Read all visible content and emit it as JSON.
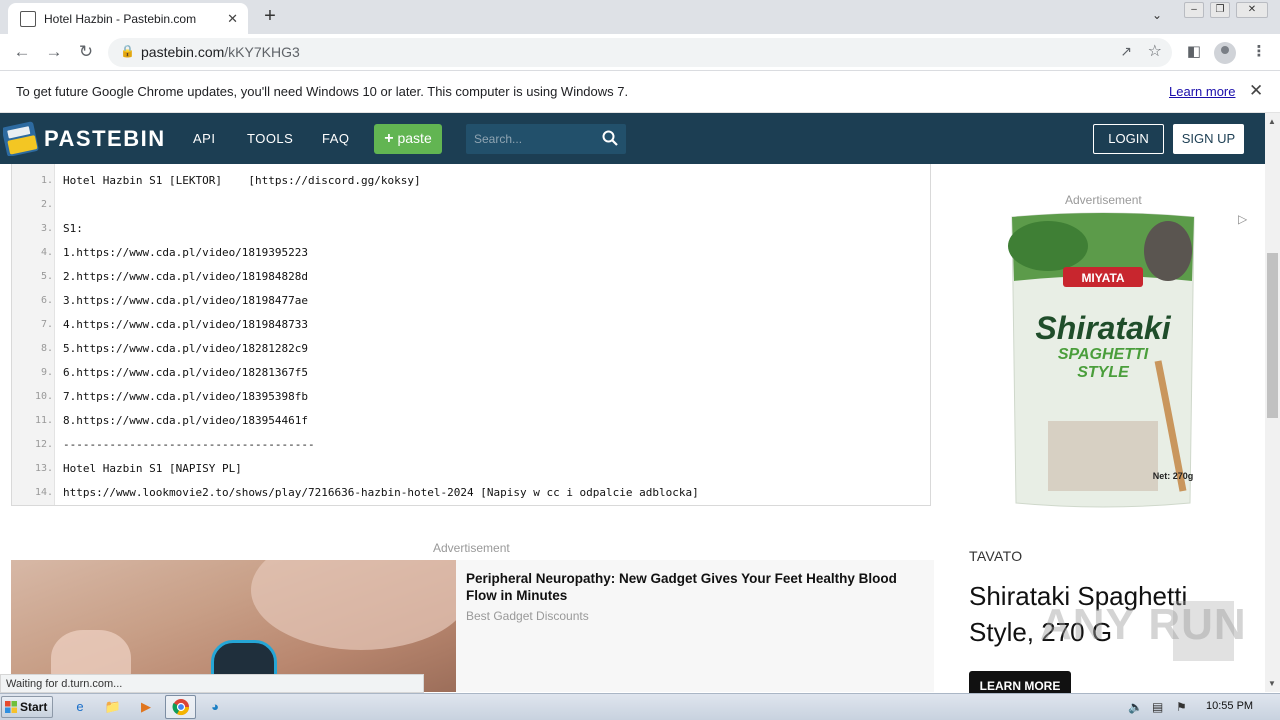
{
  "browser": {
    "tab_title": "Hotel Hazbin - Pastebin.com",
    "tab_close": "✕",
    "new_tab": "+",
    "url_host": "pastebin.com",
    "url_path": "/kKY7KHG3",
    "infobar_message": "To get future Google Chrome updates, you'll need Windows 10 or later. This computer is using Windows 7.",
    "infobar_link": "Learn more",
    "status_text": "Waiting for d.turn.com..."
  },
  "header": {
    "brand": "PASTEBIN",
    "nav": [
      "API",
      "TOOLS",
      "FAQ"
    ],
    "paste_label": "paste",
    "search_placeholder": "Search...",
    "login": "LOGIN",
    "signup": "SIGN UP"
  },
  "paste": {
    "lines": [
      {
        "n": "1.",
        "text": "Hotel Hazbin S1 [LEKTOR]    [https://discord.gg/koksy]"
      },
      {
        "n": "2.",
        "text": ""
      },
      {
        "n": "3.",
        "text": "S1:"
      },
      {
        "n": "4.",
        "text": "1.https://www.cda.pl/video/1819395223"
      },
      {
        "n": "5.",
        "text": "2.https://www.cda.pl/video/181984828d"
      },
      {
        "n": "6.",
        "text": "3.https://www.cda.pl/video/18198477ae"
      },
      {
        "n": "7.",
        "text": "4.https://www.cda.pl/video/1819848733"
      },
      {
        "n": "8.",
        "text": "5.https://www.cda.pl/video/18281282c9"
      },
      {
        "n": "9.",
        "text": "6.https://www.cda.pl/video/18281367f5"
      },
      {
        "n": "10.",
        "text": "7.https://www.cda.pl/video/18395398fb"
      },
      {
        "n": "11.",
        "text": "8.https://www.cda.pl/video/183954461f"
      },
      {
        "n": "12.",
        "text": "--------------------------------------"
      },
      {
        "n": "13.",
        "text": "Hotel Hazbin S1 [NAPISY PL]"
      },
      {
        "n": "14.",
        "text": "https://www.lookmovie2.to/shows/play/7216636-hazbin-hotel-2024 [Napisy w cc i odpalcie adblocka]"
      }
    ]
  },
  "ads": {
    "label": "Advertisement",
    "bottom": {
      "headline_line1": "Peripheral Neuropathy: New Gadget Gives Your Feet Healthy Blood",
      "headline_line2": "Flow in Minutes",
      "source": "Best Gadget Discounts"
    },
    "side": {
      "product_brand": "MIYATA",
      "product_name": "Shirataki",
      "product_sub1": "SPAGHETTI",
      "product_sub2": "STYLE",
      "product_net": "Net: 270g",
      "advertiser": "TAVATO",
      "headline": "Shirataki Spaghetti Style, 270 G",
      "cta": "LEARN MORE"
    },
    "watermark": "ANY RUN"
  },
  "taskbar": {
    "start": "Start",
    "clock": "10:55 PM"
  },
  "colors": {
    "pastebin_header": "#1c3e53",
    "paste_button": "#62b552",
    "link": "#1a0dab"
  }
}
